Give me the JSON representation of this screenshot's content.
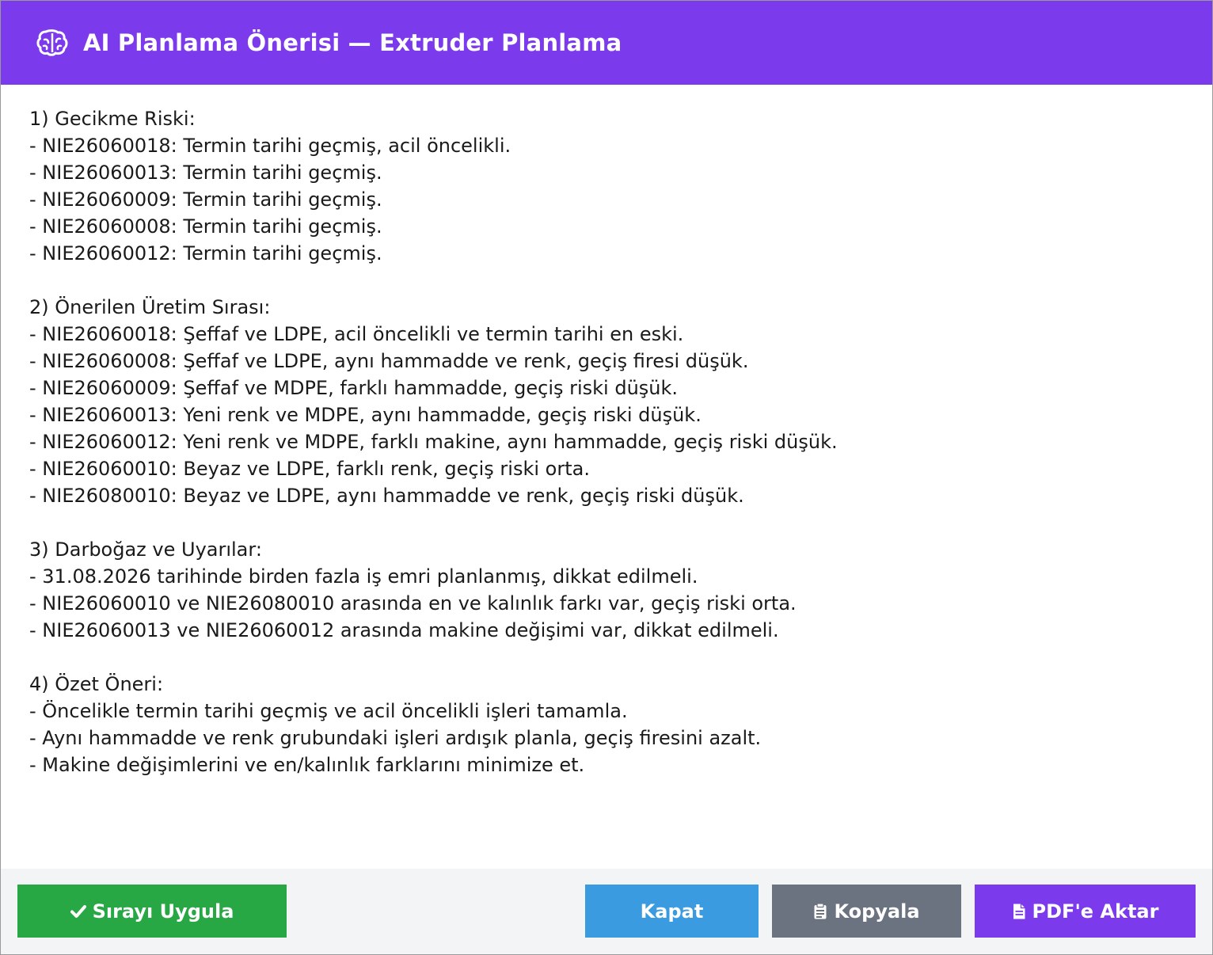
{
  "dialog": {
    "title": "AI Planlama Önerisi — Extruder Planlama",
    "icon": "brain-icon",
    "header_color": "#7c3aed"
  },
  "sections": [
    {
      "lines": [
        "1) Gecikme Riski:",
        "- NIE26060018: Termin tarihi geçmiş, acil öncelikli.",
        "- NIE26060013: Termin tarihi geçmiş.",
        "- NIE26060009: Termin tarihi geçmiş.",
        "- NIE26060008: Termin tarihi geçmiş.",
        "- NIE26060012: Termin tarihi geçmiş."
      ]
    },
    {
      "lines": [
        "2) Önerilen Üretim Sırası:",
        "- NIE26060018: Şeffaf ve LDPE, acil öncelikli ve termin tarihi en eski.",
        "- NIE26060008: Şeffaf ve LDPE, aynı hammadde ve renk, geçiş firesi düşük.",
        "- NIE26060009: Şeffaf ve MDPE, farklı hammadde, geçiş riski düşük.",
        "- NIE26060013: Yeni renk ve MDPE, aynı hammadde, geçiş riski düşük.",
        "- NIE26060012: Yeni renk ve MDPE, farklı makine, aynı hammadde, geçiş riski düşük.",
        "- NIE26060010: Beyaz ve LDPE, farklı renk, geçiş riski orta.",
        "- NIE26080010: Beyaz ve LDPE, aynı hammadde ve renk, geçiş riski düşük."
      ]
    },
    {
      "lines": [
        "3) Darboğaz ve Uyarılar:",
        "- 31.08.2026 tarihinde birden fazla iş emri planlanmış, dikkat edilmeli.",
        "- NIE26060010 ve NIE26080010 arasında en ve kalınlık farkı var, geçiş riski orta.",
        "- NIE26060013 ve NIE26060012 arasında makine değişimi var, dikkat edilmeli."
      ]
    },
    {
      "lines": [
        "4) Özet Öneri:",
        "- Öncelikle termin tarihi geçmiş ve acil öncelikli işleri tamamla.",
        "- Aynı hammadde ve renk grubundaki işleri ardışık planla, geçiş firesini azalt.",
        "- Makine değişimlerini ve en/kalınlık farklarını minimize et."
      ]
    }
  ],
  "buttons": {
    "apply": {
      "label": "Sırayı Uygula",
      "icon": "check-icon",
      "color": "#28a745"
    },
    "close": {
      "label": "Kapat",
      "color": "#3b9be0"
    },
    "copy": {
      "label": "Kopyala",
      "icon": "clipboard-icon",
      "color": "#6b7280"
    },
    "pdf": {
      "label": "PDF'e Aktar",
      "icon": "document-icon",
      "color": "#7c3aed"
    }
  }
}
